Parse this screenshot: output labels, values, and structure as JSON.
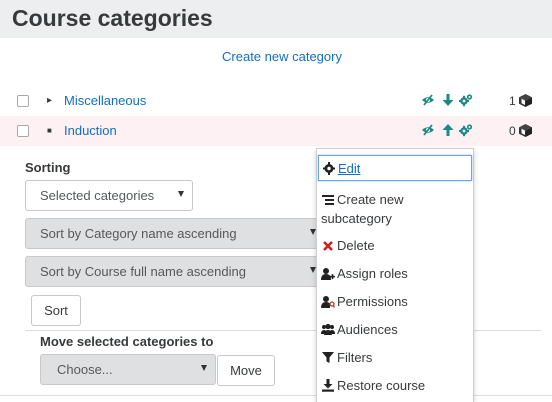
{
  "page": {
    "title": "Course categories"
  },
  "create_link": "Create new category",
  "categories": [
    {
      "name": "Miscellaneous",
      "expander": "▸",
      "count": "1",
      "move_arrow": "down"
    },
    {
      "name": "Induction",
      "expander": "■",
      "count": "0",
      "move_arrow": "up"
    }
  ],
  "sorting": {
    "label": "Sorting",
    "scope_select": "Selected categories",
    "category_sort_select": "Sort by Category name ascending",
    "course_sort_select": "Sort by Course full name ascending",
    "sort_button": "Sort"
  },
  "move": {
    "label": "Move selected categories to",
    "select_placeholder": "Choose...",
    "move_button": "Move"
  },
  "action_menu": {
    "items": [
      {
        "label": "Edit",
        "icon": "gear-icon"
      },
      {
        "label": "Create new subcategory",
        "label_line1": "Create new",
        "label_line2": "subcategory",
        "icon": "list-icon"
      },
      {
        "label": "Delete",
        "icon": "delete-x-icon"
      },
      {
        "label": "Assign roles",
        "icon": "assign-roles-icon"
      },
      {
        "label": "Permissions",
        "icon": "permissions-icon"
      },
      {
        "label": "Audiences",
        "icon": "users-icon"
      },
      {
        "label": "Filters",
        "icon": "filter-icon"
      },
      {
        "label": "Restore course",
        "icon": "restore-icon"
      }
    ]
  },
  "colors": {
    "link": "#0f6fc5",
    "action_icon": "#1a8a87",
    "delete_icon": "#cc2020",
    "highlight_row": "#fdf1f4",
    "header_bg": "#eceeef"
  }
}
